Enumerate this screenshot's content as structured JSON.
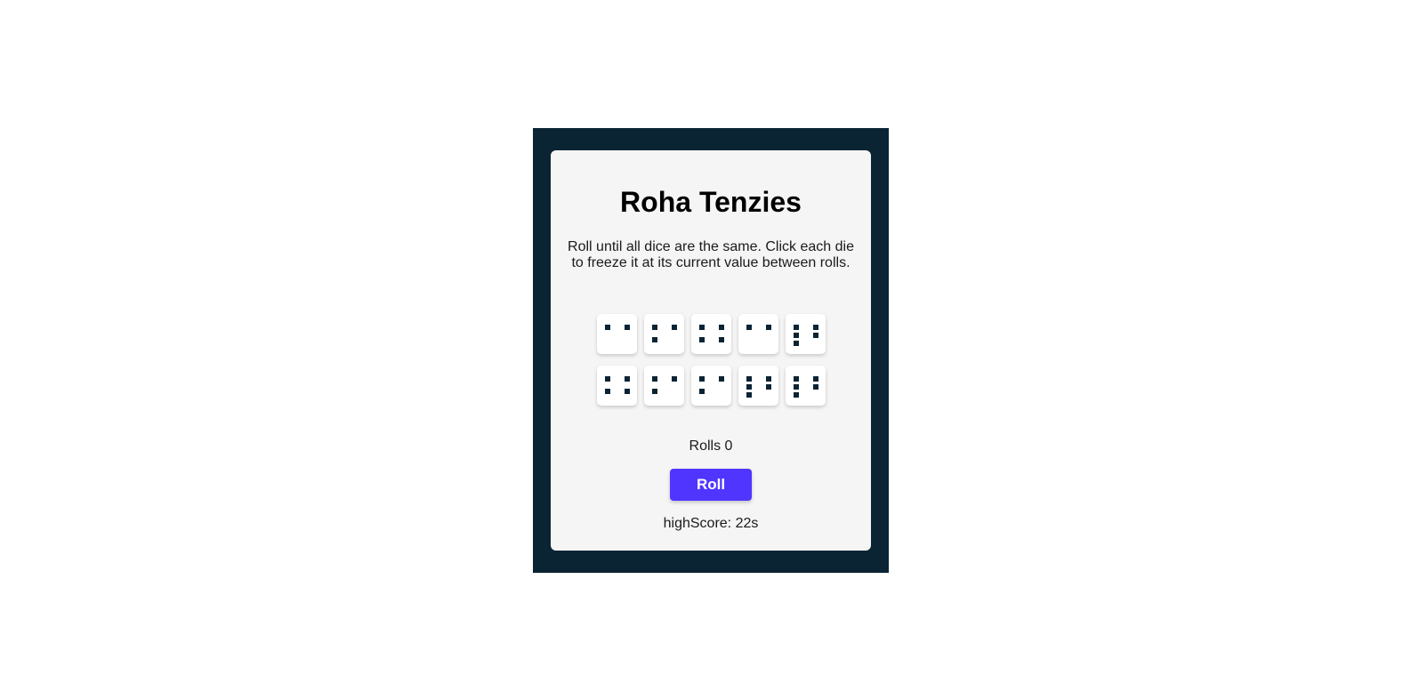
{
  "game": {
    "title": "Roha Tenzies",
    "instructions": "Roll until all dice are the same. Click each die to freeze it at its current value between rolls.",
    "rolls_label": "Rolls 0",
    "roll_button_label": "Roll",
    "highscore_label": "highScore: 22s"
  },
  "dice": [
    {
      "value": 2,
      "held": false
    },
    {
      "value": 3,
      "held": false
    },
    {
      "value": 4,
      "held": false
    },
    {
      "value": 2,
      "held": false
    },
    {
      "value": 5,
      "held": false
    },
    {
      "value": 4,
      "held": false
    },
    {
      "value": 3,
      "held": false
    },
    {
      "value": 3,
      "held": false
    },
    {
      "value": 5,
      "held": false
    },
    {
      "value": 5,
      "held": false
    }
  ],
  "colors": {
    "frame": "#0b2434",
    "card": "#f5f5f5",
    "pip": "#0b2434",
    "accent": "#5035ff"
  }
}
